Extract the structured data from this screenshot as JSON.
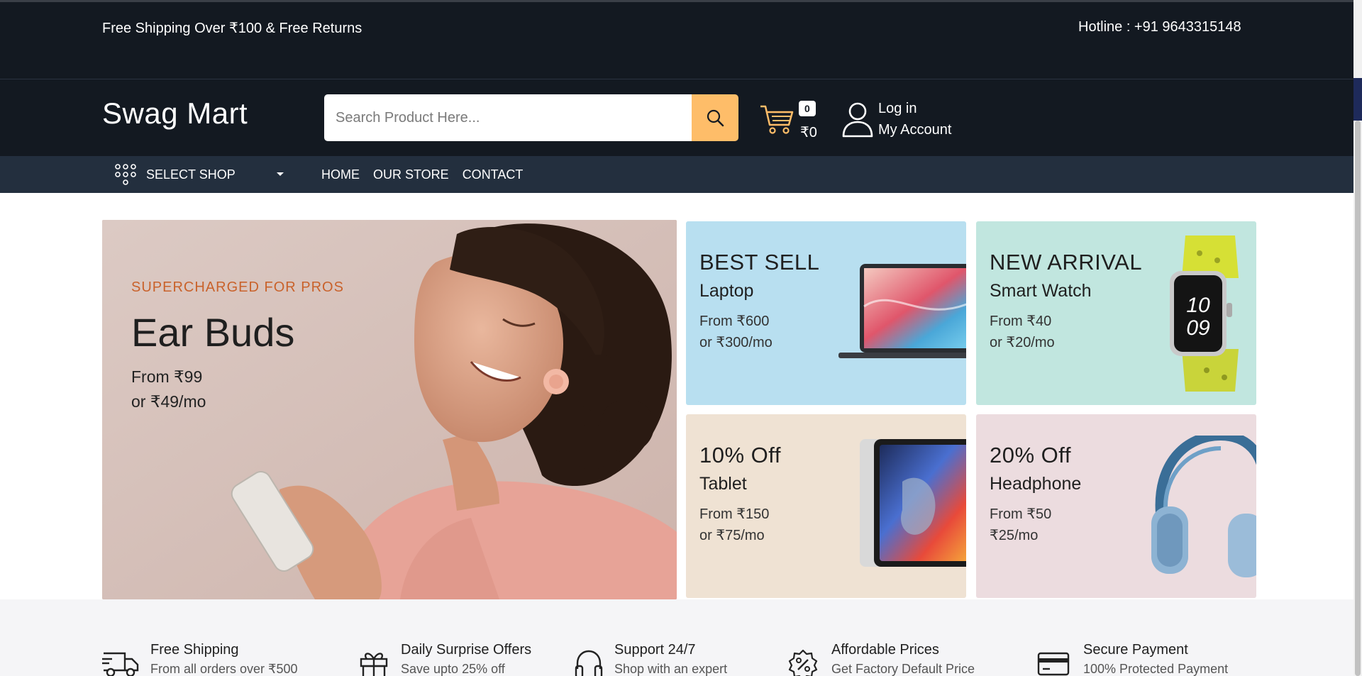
{
  "topbar": {
    "shipping": "Free Shipping Over ₹100 & Free Returns",
    "hotline": "Hotline : +91 9643315148"
  },
  "header": {
    "logo": "Swag Mart",
    "search_placeholder": "Search Product Here...",
    "cart_count": "0",
    "cart_total": "₹0",
    "login": "Log in",
    "account": "My Account"
  },
  "nav": {
    "select_shop": "SELECT SHOP",
    "links": [
      "HOME",
      "OUR STORE",
      "CONTACT"
    ]
  },
  "hero": {
    "kicker": "SUPERCHARGED FOR PROS",
    "title": "Ear Buds",
    "price": "From ₹99",
    "monthly": "or ₹49/mo"
  },
  "cards": [
    {
      "heading": "BEST SELL",
      "product": "Laptop",
      "price": "From ₹600",
      "monthly": "or ₹300/mo",
      "bg": "#b8dff0"
    },
    {
      "heading": "NEW ARRIVAL",
      "product": "Smart Watch",
      "price": "From ₹40",
      "monthly": "or ₹20/mo",
      "bg": "#c1e6df"
    },
    {
      "heading": "10% Off",
      "product": "Tablet",
      "price": "From ₹150",
      "monthly": "or ₹75/mo",
      "bg": "#efe2d3"
    },
    {
      "heading": "20% Off",
      "product": "Headphone",
      "price": "From ₹50",
      "monthly": "₹25/mo",
      "bg": "#ecdcdf"
    }
  ],
  "services": [
    {
      "title": "Free Shipping",
      "desc": "From all orders over ₹500",
      "icon": "truck-icon"
    },
    {
      "title": "Daily Surprise Offers",
      "desc": "Save upto 25% off",
      "icon": "gift-icon"
    },
    {
      "title": "Support 24/7",
      "desc": "Shop with an expert",
      "icon": "headset-icon"
    },
    {
      "title": "Affordable Prices",
      "desc": "Get Factory Default Price",
      "icon": "discount-icon"
    },
    {
      "title": "Secure Payment",
      "desc": "100% Protected Payment",
      "icon": "card-icon"
    }
  ],
  "colors": {
    "dark": "#131921",
    "nav": "#232f3e",
    "accent": "#febd69",
    "kicker": "#c9622b"
  }
}
